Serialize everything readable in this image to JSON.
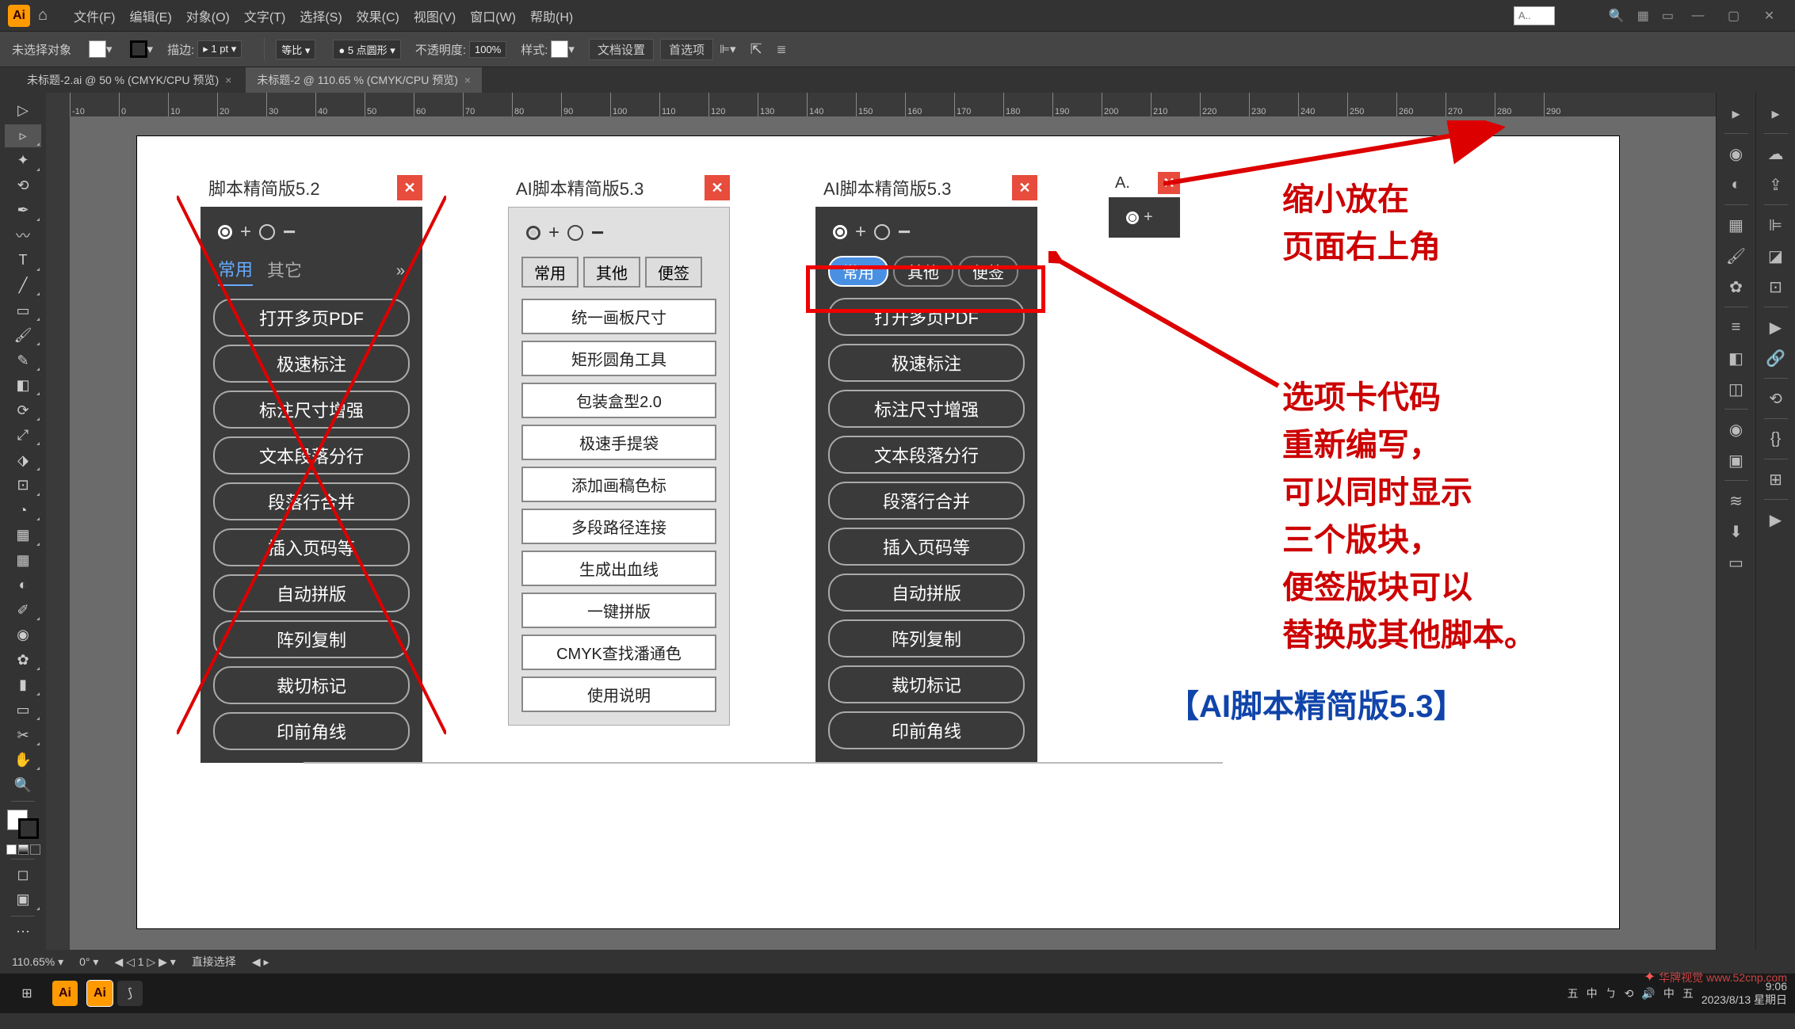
{
  "app": {
    "logo": "Ai"
  },
  "menu": {
    "items": [
      "文件(F)",
      "编辑(E)",
      "对象(O)",
      "文字(T)",
      "选择(S)",
      "效果(C)",
      "视图(V)",
      "窗口(W)",
      "帮助(H)"
    ]
  },
  "search_hint": "A..",
  "control": {
    "no_selection": "未选择对象",
    "stroke_label": "描边:",
    "stroke_val": "1 pt",
    "uniform": "等比",
    "brush_val": "5 点圆形",
    "opacity_label": "不透明度:",
    "opacity_val": "100%",
    "style_label": "样式:",
    "doc_setup": "文档设置",
    "prefs": "首选项"
  },
  "tabs": [
    {
      "name": "未标题-2.ai @ 50 % (CMYK/CPU 预览)",
      "active": false
    },
    {
      "name": "未标题-2 @ 110.65 % (CMYK/CPU 预览)",
      "active": true
    }
  ],
  "ruler_ticks": [
    "-10",
    "0",
    "10",
    "20",
    "30",
    "40",
    "50",
    "60",
    "70",
    "80",
    "90",
    "100",
    "110",
    "120",
    "130",
    "140",
    "150",
    "160",
    "170",
    "180",
    "190",
    "200",
    "210",
    "220",
    "230",
    "240",
    "250",
    "260",
    "270",
    "280",
    "290"
  ],
  "panel52": {
    "title": "脚本精简版5.2",
    "tabs": [
      "常用",
      "其它"
    ],
    "buttons": [
      "打开多页PDF",
      "极速标注",
      "标注尺寸增强",
      "文本段落分行",
      "段落行合并",
      "插入页码等",
      "自动拼版",
      "阵列复制",
      "裁切标记",
      "印前角线"
    ]
  },
  "panel53_light": {
    "title": "AI脚本精简版5.3",
    "tabs": [
      "常用",
      "其他",
      "便签"
    ],
    "buttons": [
      "统一画板尺寸",
      "矩形圆角工具",
      "包装盒型2.0",
      "极速手提袋",
      "添加画稿色标",
      "多段路径连接",
      "生成出血线",
      "一键拼版",
      "CMYK查找潘通色",
      "使用说明"
    ]
  },
  "panel53_dark": {
    "title": "AI脚本精简版5.3",
    "tabs": [
      "常用",
      "其他",
      "便签"
    ],
    "buttons": [
      "打开多页PDF",
      "极速标注",
      "标注尺寸增强",
      "文本段落分行",
      "段落行合并",
      "插入页码等",
      "自动拼版",
      "阵列复制",
      "裁切标记",
      "印前角线"
    ]
  },
  "panel_mini": {
    "title": "A."
  },
  "annotations": {
    "top": "缩小放在\n页面右上角",
    "middle": "选项卡代码\n重新编写，\n可以同时显示\n三个版块，\n便签版块可以\n替换成其他脚本。",
    "bottom": "【AI脚本精简版5.3】"
  },
  "status": {
    "zoom": "110.65%",
    "rotation": "0°",
    "artboard": "1",
    "tool": "直接选择"
  },
  "taskbar": {
    "tray_icons": [
      "五",
      "中",
      "ㄅ",
      "⟲",
      "🔊",
      "中",
      "五"
    ],
    "time": "9:06",
    "date": "2023/8/13 星期日"
  },
  "watermark": "华牌视觉 www.52cnp.com"
}
